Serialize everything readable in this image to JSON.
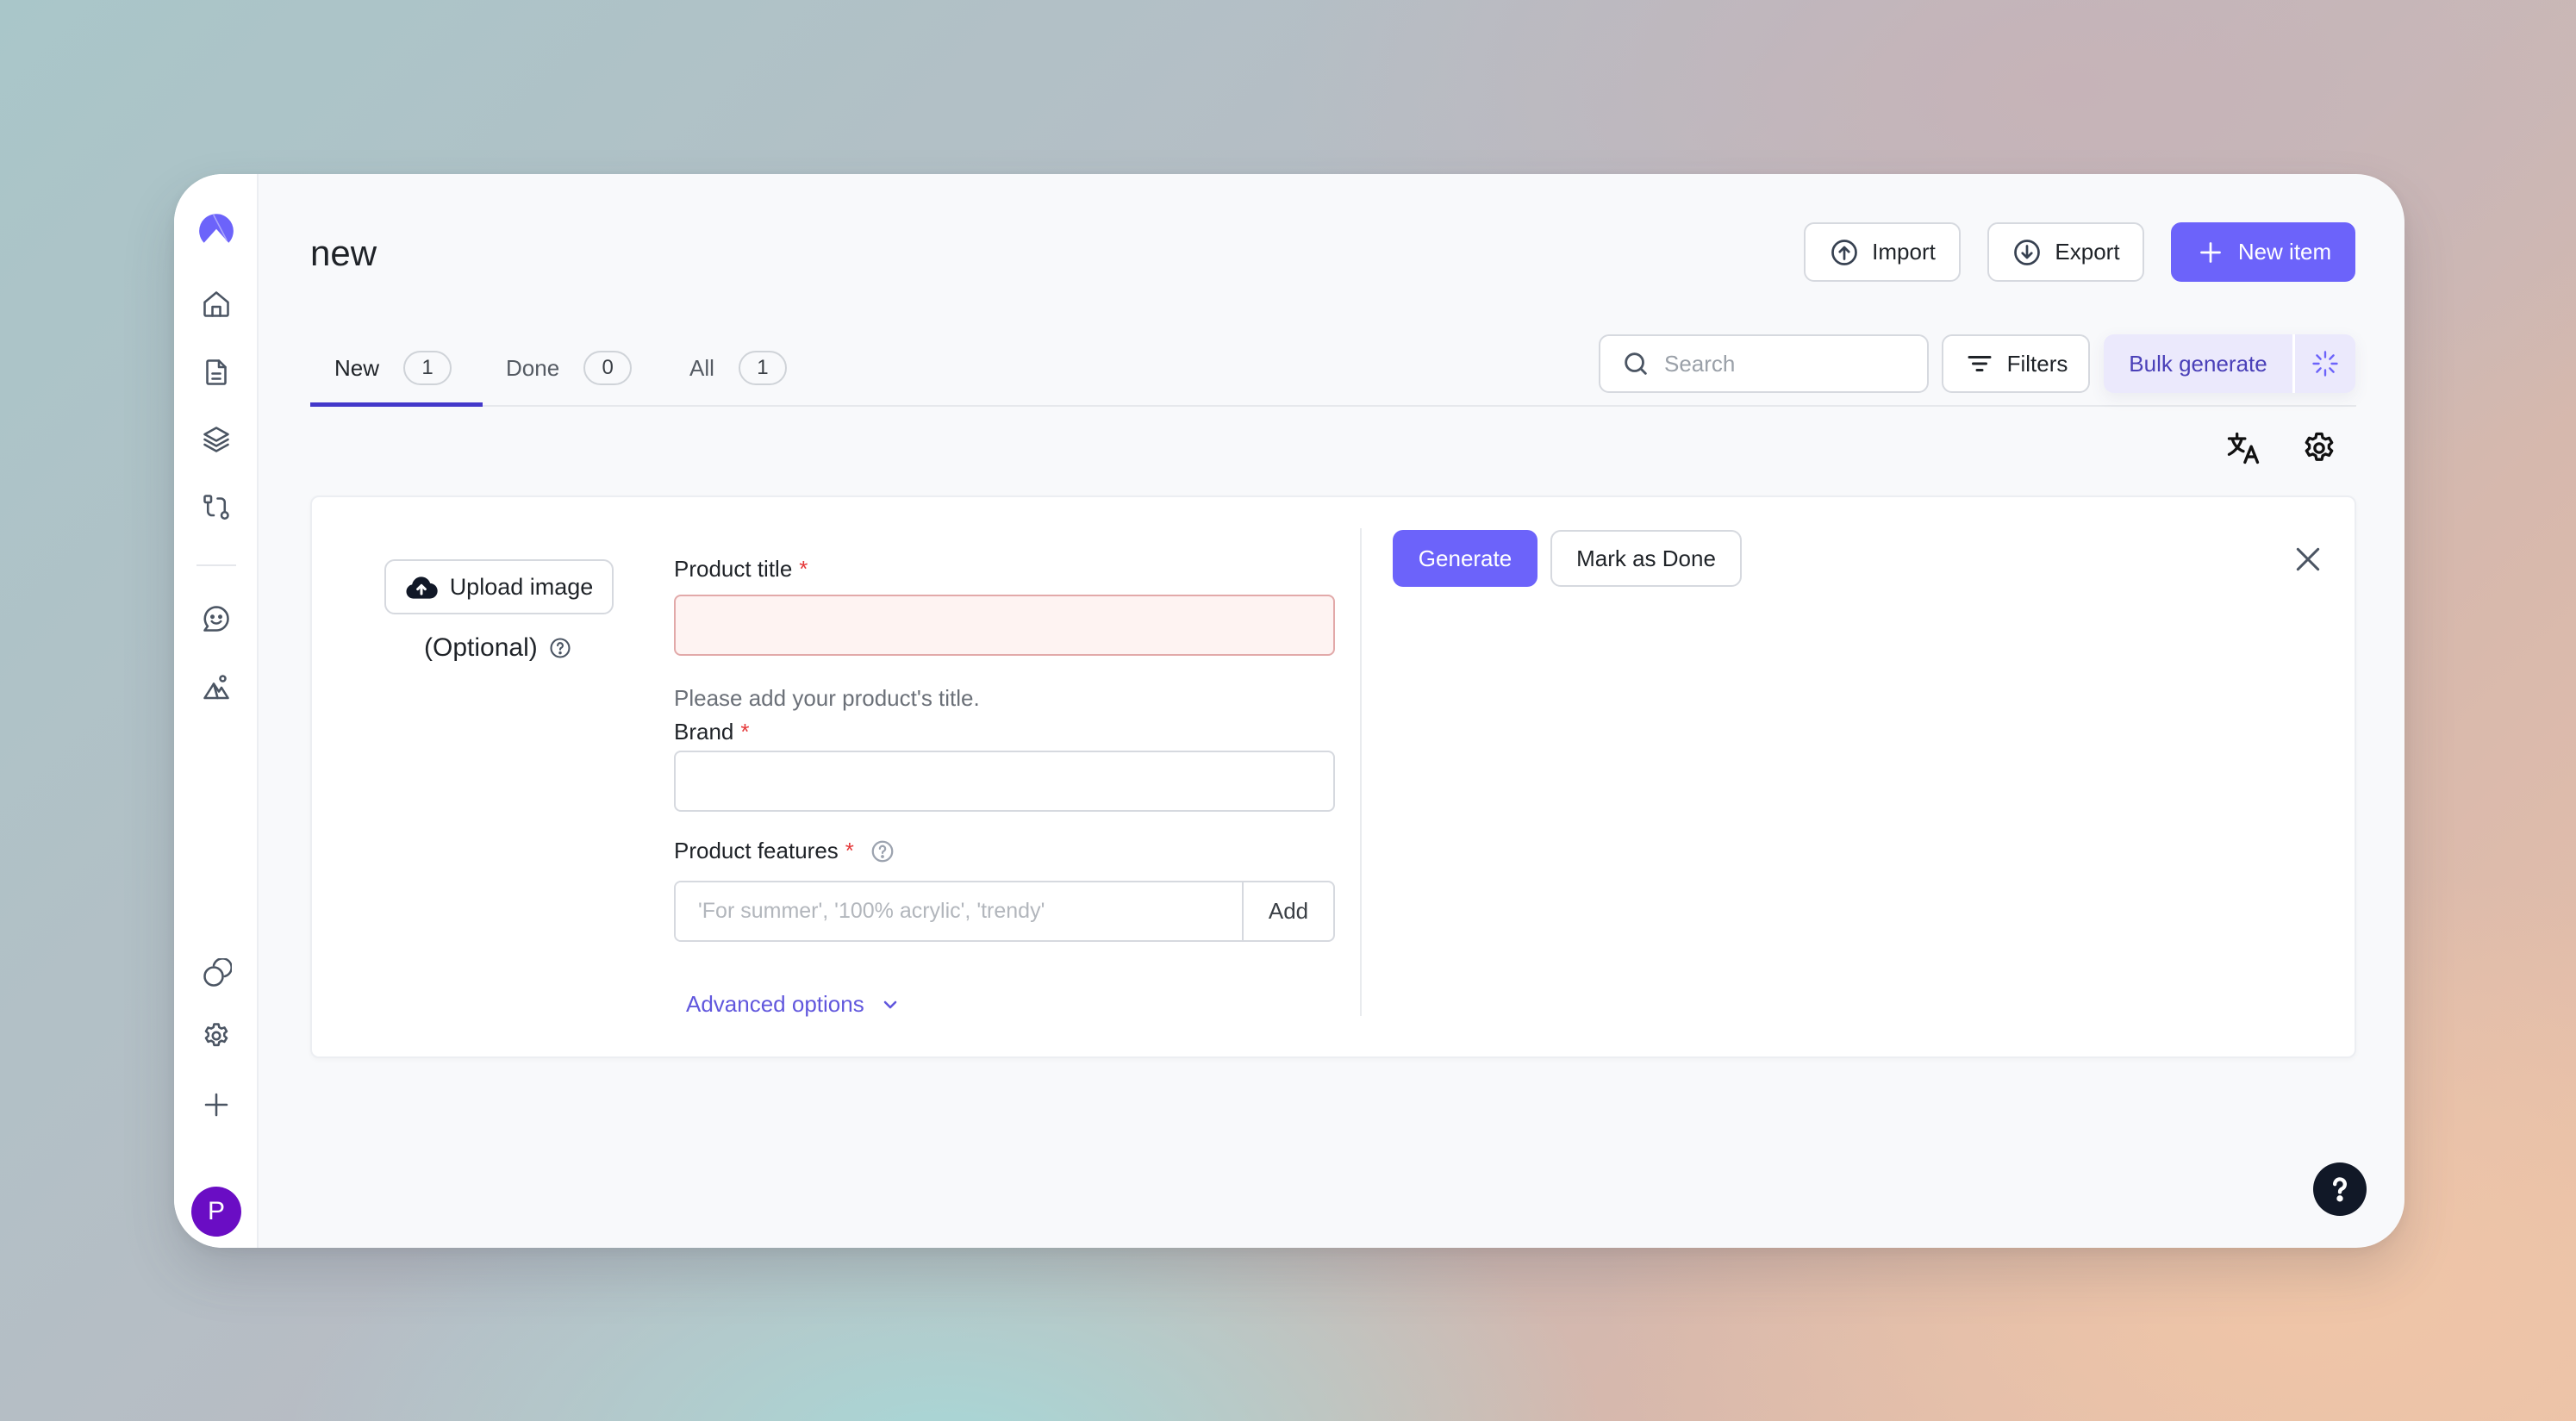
{
  "colors": {
    "accent": "#6c63fa",
    "accent_dark": "#4338ca",
    "bulk_bg": "#ebe9fc",
    "required": "#e5393a",
    "avatar": "#6a0dc4",
    "help_button": "#111827"
  },
  "sidebar": {
    "logo": "app-logo",
    "top_items": [
      {
        "name": "home",
        "icon": "home-icon"
      },
      {
        "name": "documents",
        "icon": "document-icon"
      },
      {
        "name": "layers",
        "icon": "layers-icon"
      },
      {
        "name": "workflows",
        "icon": "git-compare-icon"
      }
    ],
    "middle_items": [
      {
        "name": "chat",
        "icon": "chat-smile-icon"
      },
      {
        "name": "images",
        "icon": "landscape-icon"
      }
    ],
    "bottom_items": [
      {
        "name": "integrations",
        "icon": "circles-icon"
      },
      {
        "name": "settings",
        "icon": "gear-icon"
      },
      {
        "name": "add",
        "icon": "plus-icon"
      }
    ],
    "avatar_initial": "P"
  },
  "header": {
    "title": "new",
    "import_label": "Import",
    "export_label": "Export",
    "new_item_label": "New item"
  },
  "tabs": [
    {
      "label": "New",
      "count": "1",
      "active": true
    },
    {
      "label": "Done",
      "count": "0",
      "active": false
    },
    {
      "label": "All",
      "count": "1",
      "active": false
    }
  ],
  "toolbar": {
    "search_placeholder": "Search",
    "search_value": "",
    "filters_label": "Filters",
    "bulk_generate_label": "Bulk generate"
  },
  "form": {
    "upload_label": "Upload image",
    "optional_label": "(Optional)",
    "product_title_label": "Product title",
    "product_title_value": "",
    "product_title_error": "Please add your product's title.",
    "brand_label": "Brand",
    "brand_value": "",
    "features_label": "Product features",
    "features_placeholder": "'For summer', '100% acrylic', 'trendy'",
    "features_add_label": "Add",
    "advanced_label": "Advanced options",
    "required_mark": "*"
  },
  "actions": {
    "generate_label": "Generate",
    "mark_done_label": "Mark as Done"
  }
}
